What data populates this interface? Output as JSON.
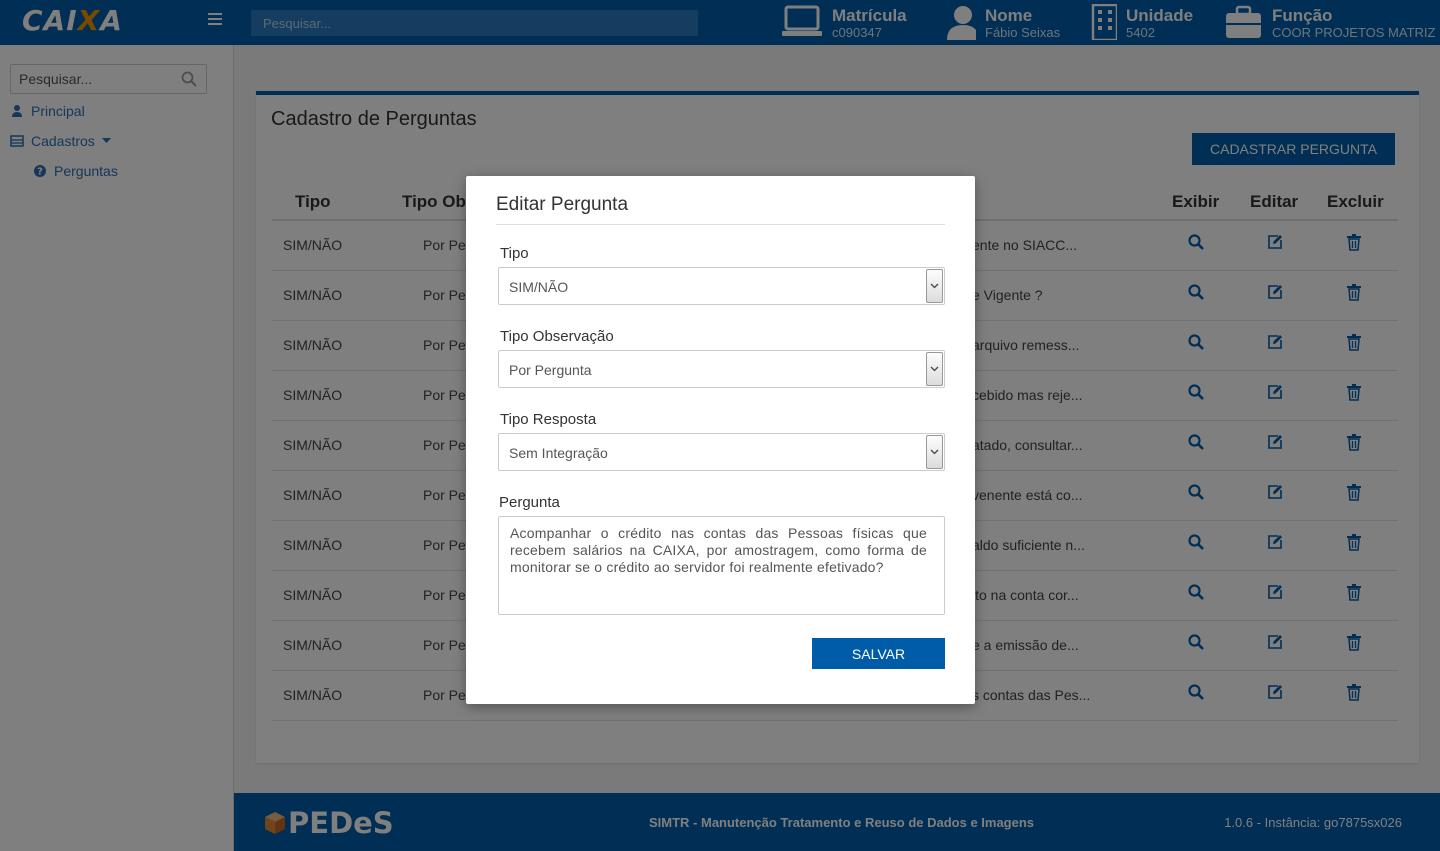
{
  "header": {
    "logo_text": "CAIXA",
    "search_placeholder": "Pesquisar...",
    "matricula_label": "Matrícula",
    "matricula_value": "c090347",
    "nome_label": "Nome",
    "nome_value": "Fábio Seixas",
    "unidade_label": "Unidade",
    "unidade_value": "5402",
    "funcao_label": "Função",
    "funcao_value": "COOR PROJETOS MATRIZ"
  },
  "sidebar": {
    "search_placeholder": "Pesquisar...",
    "items": [
      {
        "label": "Principal"
      },
      {
        "label": "Cadastros"
      },
      {
        "label": "Perguntas"
      }
    ]
  },
  "main": {
    "title": "Cadastro de Perguntas",
    "add_button": "CADASTRAR PERGUNTA",
    "columns": [
      "Tipo",
      "Tipo Obs",
      "Exibir",
      "Editar",
      "Excluir"
    ],
    "rows": [
      {
        "tipo": "SIM/NÃO",
        "obs": "Por Pe",
        "pergunta": "ente no SIACC..."
      },
      {
        "tipo": "SIM/NÃO",
        "obs": "Por Pe",
        "pergunta": "e Vigente ?"
      },
      {
        "tipo": "SIM/NÃO",
        "obs": "Por Pe",
        "pergunta": "arquivo remess..."
      },
      {
        "tipo": "SIM/NÃO",
        "obs": "Por Pe",
        "pergunta": "cebido mas reje..."
      },
      {
        "tipo": "SIM/NÃO",
        "obs": "Por Pe",
        "pergunta": "atado, consultar..."
      },
      {
        "tipo": "SIM/NÃO",
        "obs": "Por Pe",
        "pergunta": "venente está co..."
      },
      {
        "tipo": "SIM/NÃO",
        "obs": "Por Pe",
        "pergunta": "aldo suficiente n..."
      },
      {
        "tipo": "SIM/NÃO",
        "obs": "Por Pe",
        "pergunta": "ito na conta cor..."
      },
      {
        "tipo": "SIM/NÃO",
        "obs": "Por Pe",
        "pergunta": "e a emissão de..."
      },
      {
        "tipo": "SIM/NÃO",
        "obs": "Por Pe",
        "pergunta": "s contas das Pes..."
      }
    ]
  },
  "modal": {
    "title": "Editar Pergunta",
    "tipo_label": "Tipo",
    "tipo_value": "SIM/NÃO",
    "obs_label": "Tipo Observação",
    "obs_value": "Por Pergunta",
    "resp_label": "Tipo Resposta",
    "resp_value": "Sem Integração",
    "pergunta_label": "Pergunta",
    "pergunta_value": "Acompanhar o crédito nas contas das Pessoas físicas que recebem salários na CAIXA, por amostragem, como forma de monitorar se o crédito ao servidor foi realmente efetivado?",
    "save_button": "SALVAR"
  },
  "footer": {
    "logo_text": "PEDeS",
    "center_text": "SIMTR - Manutenção Tratamento e Reuso de Dados e Imagens",
    "right_text": "1.0.6 - Instância: go7875sx026"
  },
  "colors": {
    "primary": "#005ca9",
    "accent": "#f39200",
    "link": "#2a6fb3"
  }
}
